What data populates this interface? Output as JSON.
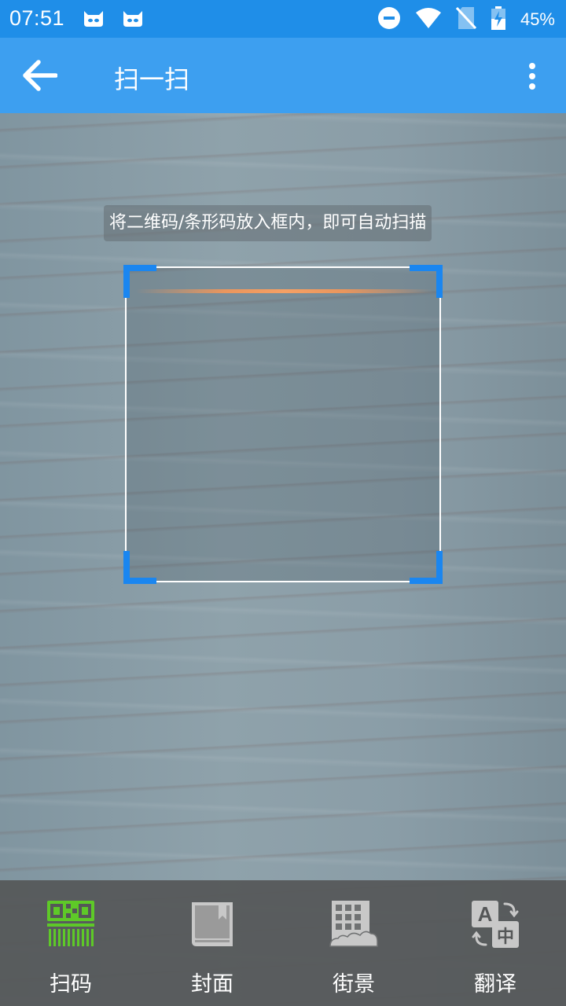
{
  "status_bar": {
    "time": "07:51",
    "battery_percent": "45%",
    "icons": [
      "cat-notification-icon",
      "cat-notification-icon",
      "do-not-disturb-icon",
      "wifi-icon",
      "no-sim-icon",
      "battery-charging-icon"
    ]
  },
  "app_bar": {
    "title": "扫一扫",
    "back_icon": "arrow-left-icon",
    "more_icon": "more-vertical-icon"
  },
  "scanner": {
    "hint": "将二维码/条形码放入框内，即可自动扫描",
    "accent_color": "#1a86f0",
    "scan_line_color": "#f5a064"
  },
  "tabs": [
    {
      "label": "扫码",
      "icon": "qr-barcode-icon",
      "active": true
    },
    {
      "label": "封面",
      "icon": "book-cover-icon",
      "active": false
    },
    {
      "label": "街景",
      "icon": "building-icon",
      "active": false
    },
    {
      "label": "翻译",
      "icon": "translate-icon",
      "active": false
    }
  ],
  "colors": {
    "status_bar": "#1f8ee8",
    "app_bar": "#3d9ff0",
    "active_tab": "#5ec928",
    "inactive_tab": "#c8c8c8"
  }
}
